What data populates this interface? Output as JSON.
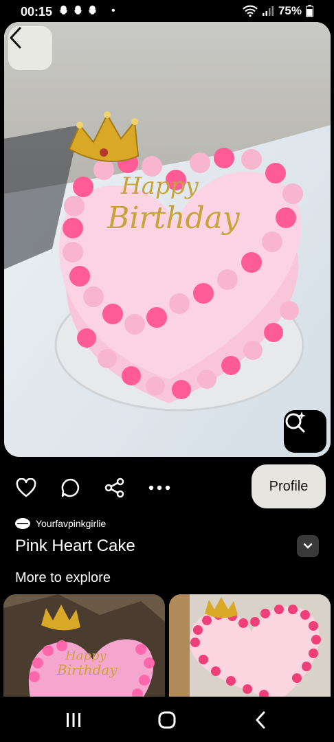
{
  "status_bar": {
    "time": "00:15",
    "notification_icons": [
      "snapchat-icon",
      "snapchat-icon",
      "snapchat-icon"
    ],
    "more_dot": "•",
    "battery": "75%"
  },
  "pin": {
    "author": "Yourfavpinkgirlie",
    "title": "Pink Heart Cake",
    "topper_text": [
      "Happy",
      "Birthday"
    ]
  },
  "actions": {
    "profile_label": "Profile"
  },
  "explore": {
    "heading": "More to explore",
    "thumb1_topper": [
      "Happy",
      "Birthday"
    ]
  },
  "colors": {
    "accent_pink": "#ff4d8d",
    "light_pink": "#f7c2d6",
    "profile_bg": "#e6e5df"
  }
}
